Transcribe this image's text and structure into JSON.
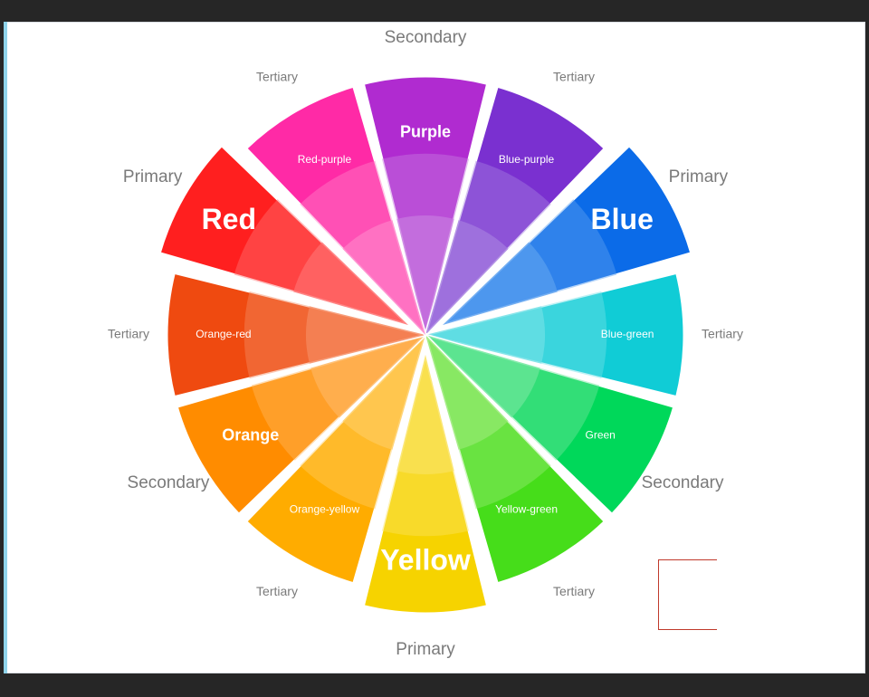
{
  "wheel": {
    "segments": [
      {
        "name": "Purple",
        "size": "mid",
        "color": "#b02bd0",
        "inner": "#c77be0",
        "category": "Secondary",
        "popped": false
      },
      {
        "name": "Blue-purple",
        "size": "small",
        "color": "#7a30d0",
        "inner": "#a57ee0",
        "category": "Tertiary",
        "popped": false
      },
      {
        "name": "Blue",
        "size": "big",
        "color": "#0b6be8",
        "inner": "#5aa0f0",
        "category": "Primary",
        "popped": true
      },
      {
        "name": "Blue-green",
        "size": "small",
        "color": "#10ccd6",
        "inner": "#6fe0e6",
        "category": "Tertiary",
        "popped": false
      },
      {
        "name": "Green",
        "size": "small",
        "color": "#00d85a",
        "inner": "#6ee79b",
        "category": "Secondary",
        "popped": false
      },
      {
        "name": "Yellow-green",
        "size": "small",
        "color": "#46dd1a",
        "inner": "#95ea72",
        "category": "Tertiary",
        "popped": false
      },
      {
        "name": "Yellow",
        "size": "big",
        "color": "#f6d300",
        "inner": "#fae25e",
        "category": "Primary",
        "popped": true
      },
      {
        "name": "Orange-yellow",
        "size": "small",
        "color": "#ffac00",
        "inner": "#ffcc5e",
        "category": "Tertiary",
        "popped": false
      },
      {
        "name": "Orange",
        "size": "mid",
        "color": "#ff8c00",
        "inner": "#ffb55c",
        "category": "Secondary",
        "popped": false
      },
      {
        "name": "Orange-red",
        "size": "small",
        "color": "#ef4a10",
        "inner": "#f58a60",
        "category": "Tertiary",
        "popped": false
      },
      {
        "name": "Red",
        "size": "big",
        "color": "#ff1f1f",
        "inner": "#ff6e6e",
        "category": "Primary",
        "popped": true
      },
      {
        "name": "Red-purple",
        "size": "small",
        "color": "#ff2aa6",
        "inner": "#ff7fc7",
        "category": "Tertiary",
        "popped": false
      }
    ]
  },
  "colors": {
    "label": "#7a7a7a",
    "marker": "#c0392b"
  }
}
